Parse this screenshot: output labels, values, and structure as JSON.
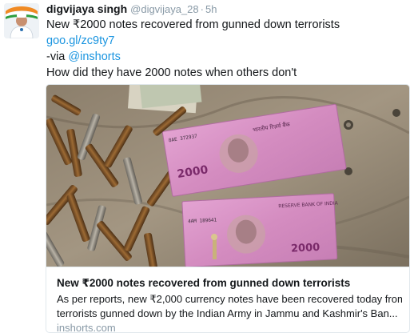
{
  "tweet": {
    "author_name": "digvijaya singh",
    "author_handle": "@digvijaya_28",
    "separator": "·",
    "timestamp": "5h",
    "text_line1": "New ₹2000 notes recovered from gunned down terrorists",
    "link_url": "goo.gl/zc9ty7",
    "via_prefix": "-via ",
    "via_handle": "@inshorts",
    "text_line4": "How did they have 2000 notes when others don't"
  },
  "card": {
    "title": "New ₹2000 notes recovered from gunned down terrorists",
    "description_line1": "As per reports, new ₹2,000 currency notes have been recovered today from",
    "description_line2": "terrorists gunned down by the Indian Army in Jammu and Kashmir's Ban...",
    "domain": "inshorts.com",
    "note_text_1": "भारतीय रिज़र्व बैंक",
    "note_text_2": "RESERVE BANK OF INDIA",
    "note_serial_1": "8AE 372937",
    "note_serial_2": "4AM 189641",
    "note_value": "2000"
  },
  "colors": {
    "link": "#1b95e0",
    "muted": "#8899a6",
    "border": "#e1e8ed",
    "note": "#d98fc4"
  },
  "icons": {
    "avatar": "profile-photo"
  }
}
